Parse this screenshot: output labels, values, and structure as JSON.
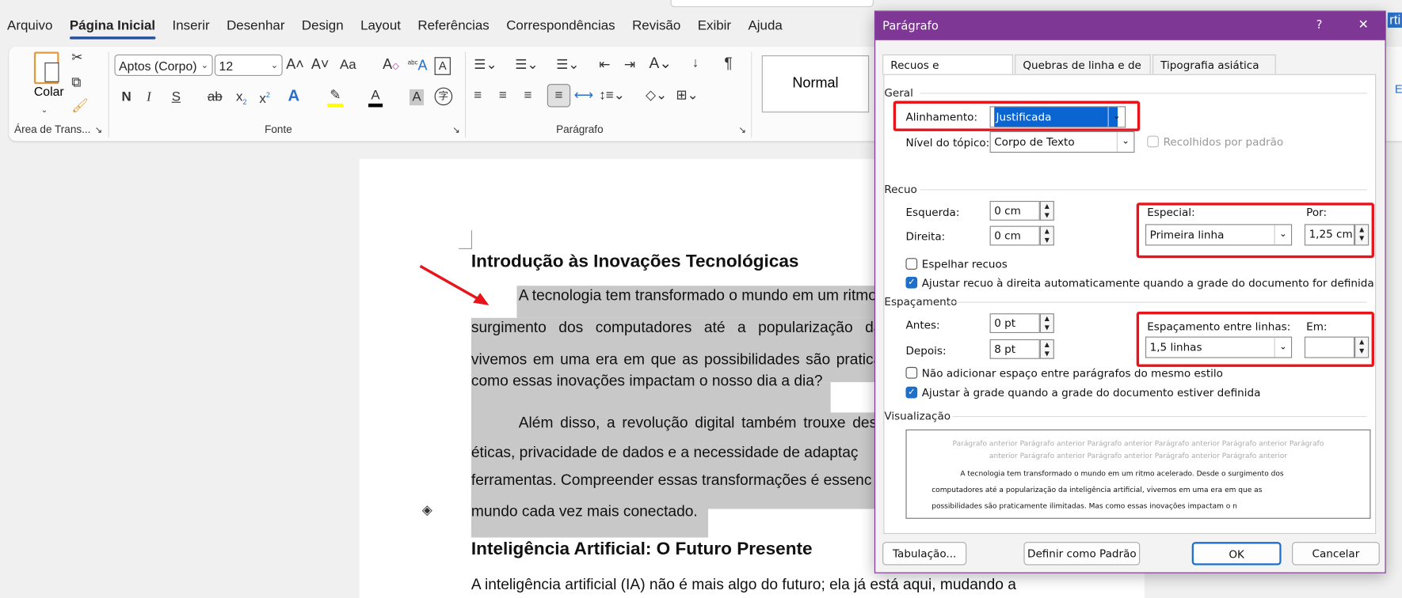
{
  "menu_tabs": [
    "Arquivo",
    "Página Inicial",
    "Inserir",
    "Desenhar",
    "Design",
    "Layout",
    "Referências",
    "Correspondências",
    "Revisão",
    "Exibir",
    "Ajuda"
  ],
  "active_tab": "Página Inicial",
  "ribbon": {
    "clipboard": {
      "paste_label": "Colar",
      "group_label": "Área de Trans..."
    },
    "font": {
      "font_name": "Aptos (Corpo)",
      "font_size": "12",
      "group_label": "Fonte",
      "bold": "N",
      "italic": "I",
      "underline": "S",
      "change_case": "Aa",
      "highlight_color": "#ffff00",
      "font_color": "#000000"
    },
    "paragraph": {
      "group_label": "Parágrafo",
      "pilcrow": "¶"
    },
    "styles": {
      "normal": "Normal"
    },
    "right_partial": {
      "text": "rti",
      "label": "E"
    }
  },
  "document": {
    "heading1": "Introdução às Inovações Tecnológicas",
    "para1_lines": [
      "A tecnologia tem transformado o mundo em um ritmo",
      "surgimento dos computadores até a popularização da",
      "vivemos em uma era em que as possibilidades são pratica",
      "como essas inovações impactam o nosso dia a dia?"
    ],
    "para2_lines": [
      "Além disso, a revolução digital também trouxe des",
      "éticas, privacidade de dados e a necessidade de adaptaç",
      "ferramentas. Compreender essas transformações é essenc",
      "mundo cada vez mais conectado."
    ],
    "heading2": "Inteligência Artificial: O Futuro Presente",
    "para3_line": "A inteligência artificial (IA) não é mais algo do futuro; ela já está aqui, mudando a",
    "annotation_color": "#e8141b"
  },
  "dialog": {
    "title": "Parágrafo",
    "help": "?",
    "close": "✕",
    "tabs": [
      "Recuos e espaçamento",
      "Quebras de linha e de página",
      "Tipografia asiática"
    ],
    "general": {
      "section": "Geral",
      "alignment_label": "Alinhamento:",
      "alignment_value": "Justificada",
      "outline_label": "Nível do tópico:",
      "outline_value": "Corpo de Texto",
      "collapsed_label": "Recolhidos por padrão",
      "collapsed_checked": false
    },
    "indent": {
      "section": "Recuo",
      "left_label": "Esquerda:",
      "left_value": "0 cm",
      "right_label": "Direita:",
      "right_value": "0 cm",
      "special_label": "Especial:",
      "special_value": "Primeira linha",
      "by_label": "Por:",
      "by_value": "1,25 cm",
      "mirror_label": "Espelhar recuos",
      "mirror_checked": false,
      "auto_adjust_label": "Ajustar recuo à direita automaticamente quando a grade do documento for definida",
      "auto_adjust_checked": true
    },
    "spacing": {
      "section": "Espaçamento",
      "before_label": "Antes:",
      "before_value": "0 pt",
      "after_label": "Depois:",
      "after_value": "8 pt",
      "line_spacing_label": "Espaçamento entre linhas:",
      "line_spacing_value": "1,5 linhas",
      "at_label": "Em:",
      "at_value": "",
      "no_space_label": "Não adicionar espaço entre parágrafos do mesmo estilo",
      "no_space_checked": false,
      "snap_grid_label": "Ajustar à grade quando a grade do documento estiver definida",
      "snap_grid_checked": true
    },
    "preview": {
      "section": "Visualização",
      "prev_lines": [
        "Parágrafo anterior Parágrafo anterior Parágrafo anterior Parágrafo anterior Parágrafo anterior Parágrafo",
        "anterior Parágrafo anterior Parágrafo anterior Parágrafo anterior Parágrafo anterior"
      ],
      "sample_lines": [
        "A tecnologia tem transformado o mundo em um ritmo acelerado. Desde o surgimento dos",
        "computadores até a popularização da inteligência artificial, vivemos em uma era em que as",
        "possibilidades são praticamente ilimitadas. Mas como essas inovações impactam o n"
      ]
    },
    "buttons": {
      "tabs": "Tabulação...",
      "default": "Definir como Padrão",
      "ok": "OK",
      "cancel": "Cancelar"
    },
    "title_color": "#7e3794"
  }
}
